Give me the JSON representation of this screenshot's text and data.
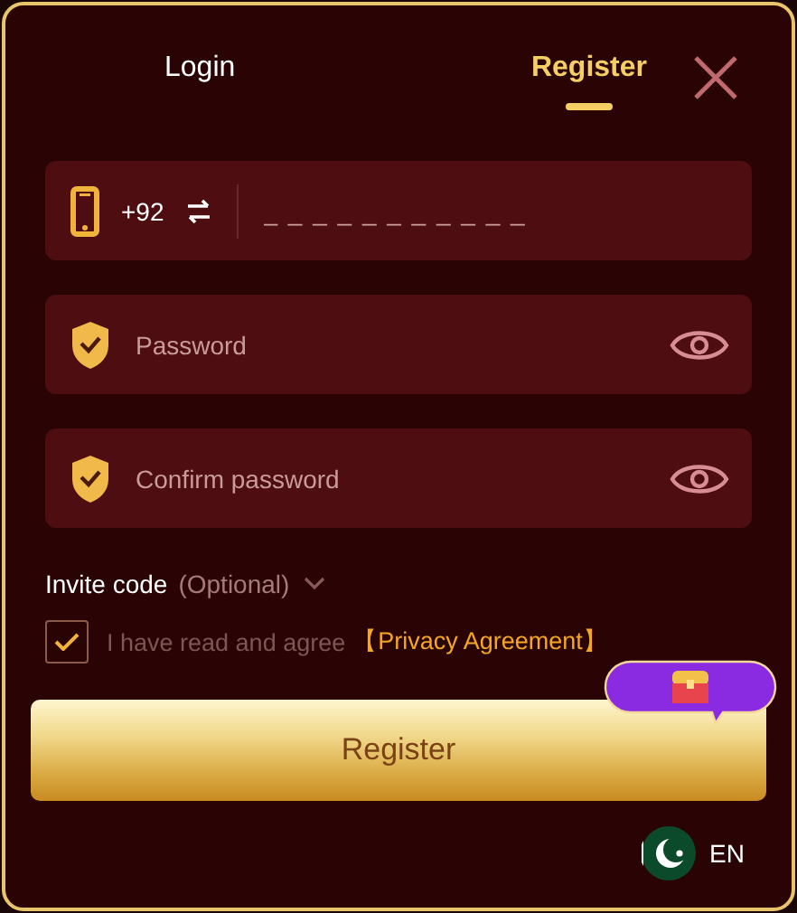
{
  "tabs": [
    {
      "label": "Login",
      "selected": false
    },
    {
      "label": "Register",
      "selected": true
    }
  ],
  "phone": {
    "country_code": "+92",
    "placeholder": "_ _ _ _ _ _ _ _ _ _ _"
  },
  "password_fields": [
    {
      "placeholder": "Password"
    },
    {
      "placeholder": "Confirm password"
    }
  ],
  "invite": {
    "label": "Invite code",
    "hint": "(Optional)",
    "expanded": false
  },
  "agreement": {
    "checked": true,
    "text": "I have read and agree",
    "link": "【Privacy Agreement】"
  },
  "register_button": "Register",
  "language": "EN"
}
